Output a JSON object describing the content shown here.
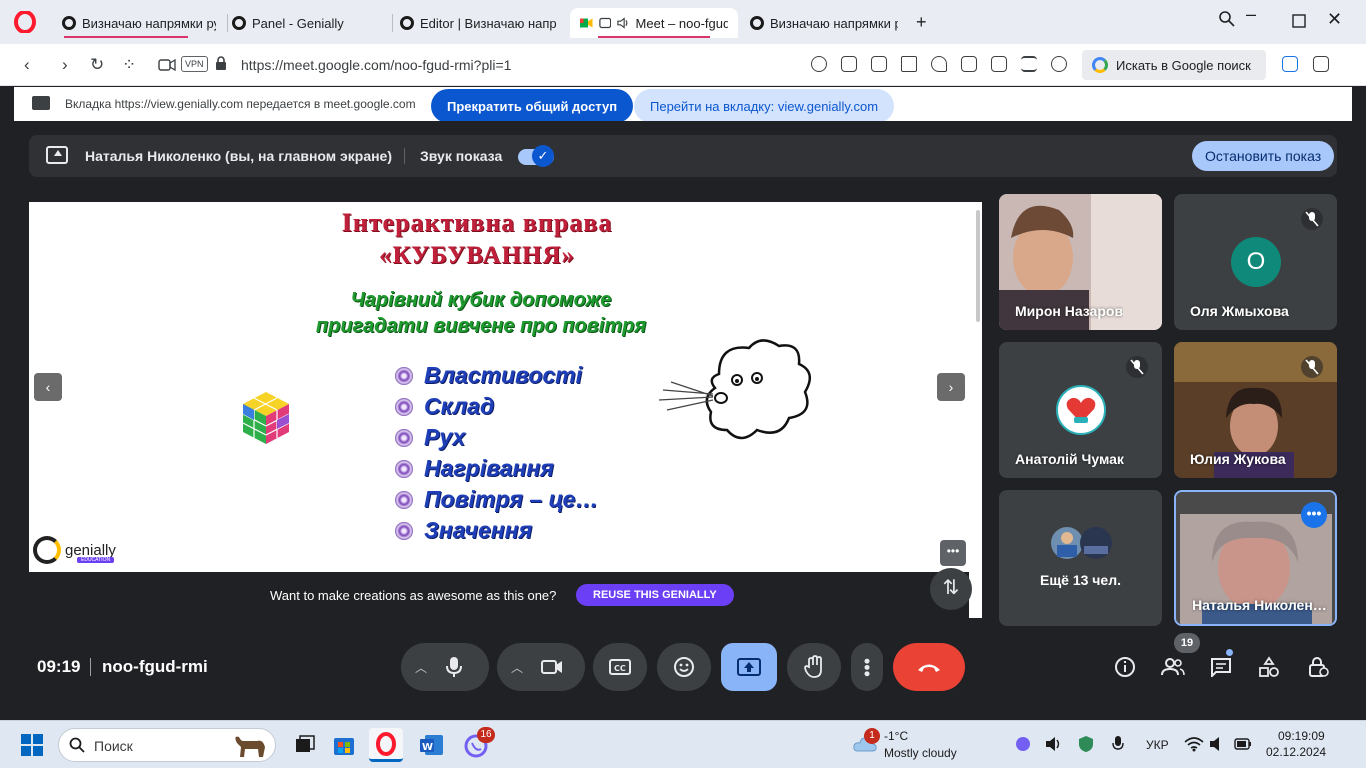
{
  "browser": {
    "tabs": [
      {
        "label": "Визначаю напрямки рух",
        "active": false
      },
      {
        "label": "Panel - Genially",
        "active": false
      },
      {
        "label": "Editor | Визначаю напрям",
        "active": false
      },
      {
        "label": "Meet – noo-fgud-r",
        "active": true
      },
      {
        "label": "Визначаю напрямки рух",
        "active": false
      }
    ],
    "url": "https://meet.google.com/noo-fgud-rmi?pli=1",
    "vpn_label": "VPN",
    "search_label": "Искать в Google поиск"
  },
  "sharebar": {
    "message": "Вкладка https://view.genially.com передается в meet.google.com",
    "stop_button": "Прекратить общий доступ",
    "goto_button": "Перейти на вкладку: view.genially.com"
  },
  "present": {
    "name": "Наталья Николенко (вы, на главном экране)",
    "sound_label": "Звук показа",
    "stop_button": "Остановить показ"
  },
  "slide": {
    "title_line1": "Інтерактивна   вправа",
    "title_line2": "«КУБУВАННЯ»",
    "sub_line1": "Чарівний   кубик   допоможе",
    "sub_line2": "пригадати   вивчене  про повітря",
    "bullets": [
      "Властивості",
      "Склад",
      "Рух",
      "Нагрівання",
      "Повітря – це…",
      "Значення"
    ],
    "brand": "genially",
    "brand_tag": "EDUCATION",
    "promo_text": "Want to make creations as awesome as this one?",
    "promo_button": "REUSE THIS GENIALLY"
  },
  "participants": [
    {
      "name": "Мирон Назаров",
      "muted": false
    },
    {
      "name": "Оля Жмыхова",
      "muted": true,
      "initial": "O"
    },
    {
      "name": "Анатолій Чумак",
      "muted": true
    },
    {
      "name": "Юлия Жукова",
      "muted": true
    },
    {
      "name": "Ещё 13 чел."
    },
    {
      "name": "Наталья Николен…",
      "muted": false
    }
  ],
  "meeting": {
    "time": "09:19",
    "code": "noo-fgud-rmi",
    "participant_count": "19"
  },
  "taskbar": {
    "search_label": "Поиск",
    "teams_badge": "16",
    "weather_badge": "1",
    "weather_temp": "-1°C",
    "weather_desc": "Mostly cloudy",
    "lang": "УКР",
    "time": "09:19:09",
    "date": "02.12.2024"
  },
  "colors": {
    "meet_bg": "#202124",
    "tile_bg": "#3c4043",
    "accent_blue": "#8ab4f8",
    "end_call_red": "#ea4335",
    "genially_purple": "#6b3ff5",
    "slide_title_red": "#c0203a",
    "slide_sub_green": "#1f9a2f",
    "slide_bullet_blue": "#1f3fb8"
  }
}
